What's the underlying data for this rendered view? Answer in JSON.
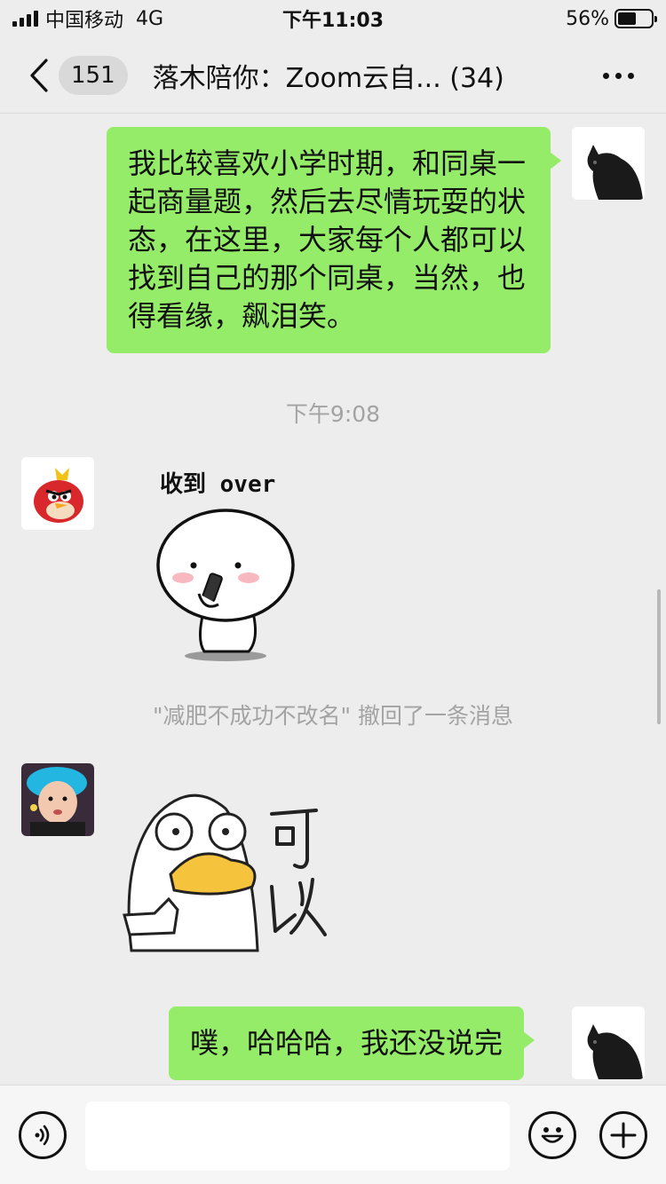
{
  "status_bar": {
    "carrier": "中国移动",
    "network": "4G",
    "time": "下午11:03",
    "battery_percent": "56%",
    "battery_level": 0.56
  },
  "nav": {
    "unread_count": "151",
    "title": "落木陪你：Zoom云自... (34)",
    "back_icon": "chevron-left-icon",
    "more_icon": "more-dots-icon"
  },
  "messages": {
    "msg1_text": "我比较喜欢小学时期，和同桌一起商量题，然后去尽情玩耍的状态，在这里，大家每个人都可以找到自己的那个同桌，当然，也得看缘，飙泪笑。",
    "timestamp1": "下午9:08",
    "sticker1_caption": "收到 over",
    "system_msg": "\"减肥不成功不改名\" 撤回了一条消息",
    "sticker2_caption": "可以",
    "msg2_text": "噗，哈哈哈，我还没说完"
  },
  "input_bar": {
    "voice_icon": "voice-icon",
    "emoji_icon": "emoji-icon",
    "plus_icon": "plus-icon",
    "input_placeholder": ""
  },
  "colors": {
    "bubble_green": "#95ec69",
    "background": "#ededed"
  }
}
